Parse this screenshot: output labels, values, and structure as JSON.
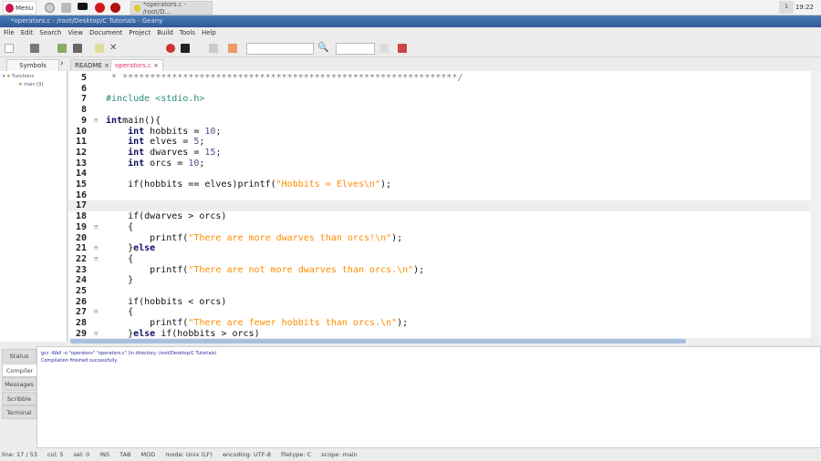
{
  "taskbar": {
    "menu_label": "Menu",
    "task_label": "*operators.c - /root/D...",
    "keyboard": "1",
    "clock": "19:22"
  },
  "window_title": "*operators.c - /root/Desktop/C Tutorials - Geany",
  "menubar": [
    "File",
    "Edit",
    "Search",
    "View",
    "Document",
    "Project",
    "Build",
    "Tools",
    "Help"
  ],
  "sidebar": {
    "tab": "Symbols",
    "tree": [
      {
        "label": "Functions"
      },
      {
        "label": "main [9]"
      }
    ]
  },
  "tabs": [
    {
      "label": "README",
      "active": false
    },
    {
      "label": "operators.c",
      "active": true
    }
  ],
  "colors": {
    "accent_title": "#2d5a95",
    "string": "#ff8c00",
    "active_tab": "#e0306a"
  },
  "code": [
    {
      "n": "5",
      "t": [
        [
          "cm",
          " * *************************************************************/"
        ]
      ]
    },
    {
      "n": "6",
      "t": []
    },
    {
      "n": "7",
      "t": [
        [
          "pp",
          "#include <stdio.h>"
        ]
      ]
    },
    {
      "n": "8",
      "t": []
    },
    {
      "n": "9",
      "fold": true,
      "t": [
        [
          "kw",
          "int"
        ],
        [
          "",
          "main(){"
        ]
      ]
    },
    {
      "n": "10",
      "t": [
        [
          "",
          "    "
        ],
        [
          "kw",
          "int"
        ],
        [
          "",
          " hobbits = "
        ],
        [
          "num",
          "10"
        ],
        [
          "",
          ";"
        ]
      ]
    },
    {
      "n": "11",
      "t": [
        [
          "",
          "    "
        ],
        [
          "kw",
          "int"
        ],
        [
          "",
          " elves = "
        ],
        [
          "num",
          "5"
        ],
        [
          "",
          ";"
        ]
      ]
    },
    {
      "n": "12",
      "t": [
        [
          "",
          "    "
        ],
        [
          "kw",
          "int"
        ],
        [
          "",
          " dwarves = "
        ],
        [
          "num",
          "15"
        ],
        [
          "",
          ";"
        ]
      ]
    },
    {
      "n": "13",
      "t": [
        [
          "",
          "    "
        ],
        [
          "kw",
          "int"
        ],
        [
          "",
          " orcs = "
        ],
        [
          "num",
          "10"
        ],
        [
          "",
          ";"
        ]
      ]
    },
    {
      "n": "14",
      "t": []
    },
    {
      "n": "15",
      "t": [
        [
          "",
          "    if(hobbits == elves)printf("
        ],
        [
          "str",
          "\"Hobbits = Elves\\n\""
        ],
        [
          "",
          ");"
        ]
      ]
    },
    {
      "n": "16",
      "t": []
    },
    {
      "n": "17",
      "cur": true,
      "t": []
    },
    {
      "n": "18",
      "t": [
        [
          "",
          "    if(dwarves > orcs)"
        ]
      ]
    },
    {
      "n": "19",
      "fold": true,
      "t": [
        [
          "",
          "    {"
        ]
      ]
    },
    {
      "n": "20",
      "t": [
        [
          "",
          "        printf("
        ],
        [
          "str",
          "\"There are more dwarves than orcs!\\n\""
        ],
        [
          "",
          ");"
        ]
      ]
    },
    {
      "n": "21",
      "fold": true,
      "t": [
        [
          "",
          "    }"
        ],
        [
          "kw",
          "else"
        ]
      ]
    },
    {
      "n": "22",
      "fold": true,
      "t": [
        [
          "",
          "    {"
        ]
      ]
    },
    {
      "n": "23",
      "t": [
        [
          "",
          "        printf("
        ],
        [
          "str",
          "\"There are not more dwarves than orcs.\\n\""
        ],
        [
          "",
          ");"
        ]
      ]
    },
    {
      "n": "24",
      "t": [
        [
          "",
          "    }"
        ]
      ]
    },
    {
      "n": "25",
      "t": []
    },
    {
      "n": "26",
      "t": [
        [
          "",
          "    if(hobbits < orcs)"
        ]
      ]
    },
    {
      "n": "27",
      "fold": true,
      "t": [
        [
          "",
          "    {"
        ]
      ]
    },
    {
      "n": "28",
      "t": [
        [
          "",
          "        printf("
        ],
        [
          "str",
          "\"There are fewer hobbits than orcs.\\n\""
        ],
        [
          "",
          ");"
        ]
      ]
    },
    {
      "n": "29",
      "fold": true,
      "t": [
        [
          "",
          "    }"
        ],
        [
          "kw",
          "else"
        ],
        [
          "",
          " if(hobbits > orcs)"
        ]
      ]
    }
  ],
  "panel": {
    "tabs": [
      "Status",
      "Compiler",
      "Messages",
      "Scribble",
      "Terminal"
    ],
    "active_tab": "Compiler",
    "output": [
      "gcc -Wall -o \"operators\" \"operators.c\" (in directory: /root/Desktop/C Tutorials)",
      "Compilation finished successfully."
    ]
  },
  "status": [
    "line: 17 / 53",
    "col: 5",
    "sel: 0",
    "INS",
    "TAB",
    "MOD",
    "mode: Unix (LF)",
    "encoding: UTF-8",
    "filetype: C",
    "scope: main"
  ]
}
